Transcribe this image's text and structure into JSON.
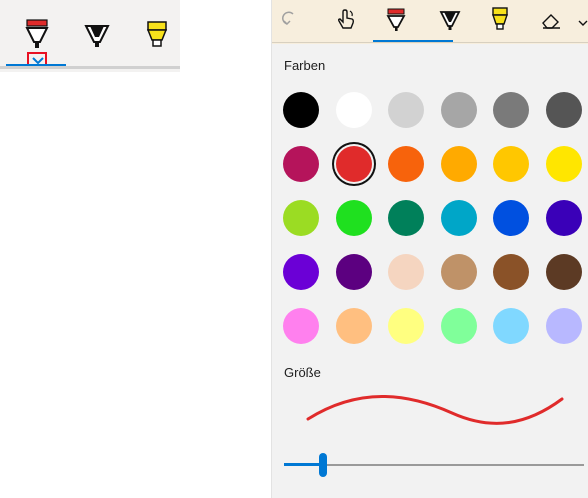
{
  "left_toolbar": {
    "tools": [
      {
        "name": "red-pen-tool",
        "icon": "pen-icon",
        "color": "#e02b2b",
        "selected": true
      },
      {
        "name": "black-pen-tool",
        "icon": "pencil-icon",
        "color": "#111111",
        "selected": false
      },
      {
        "name": "yellow-highlighter-tool",
        "icon": "highlighter-icon",
        "color": "#f7e11b",
        "selected": false
      }
    ],
    "expand_icon": "chevron-down-icon"
  },
  "panel": {
    "toolbar_icons": [
      "undo-icon",
      "touch-writing-icon",
      "red-pen-icon",
      "black-pencil-icon",
      "yellow-highlighter-icon",
      "eraser-icon"
    ],
    "colors_label": "Farben",
    "size_label": "Größe",
    "selected_color": "#e02b2b",
    "palette": [
      [
        "#000000",
        "#ffffff",
        "#d2d2d2",
        "#a6a6a6",
        "#7a7a7a",
        "#555555"
      ],
      [
        "#b5145b",
        "#e02b2b",
        "#f7630c",
        "#ffaa00",
        "#ffc700",
        "#ffe600"
      ],
      [
        "#9bdc23",
        "#1fe01f",
        "#00805a",
        "#00a6c8",
        "#0050e0",
        "#3a00b8"
      ],
      [
        "#6b00d6",
        "#5c0080",
        "#f5d5c0",
        "#bf9268",
        "#8a5228",
        "#5c3a24"
      ],
      [
        "#ff80ee",
        "#ffbf80",
        "#ffff80",
        "#80ff9a",
        "#80d8ff",
        "#b8b8ff"
      ]
    ],
    "size_slider_value": 0.13
  }
}
